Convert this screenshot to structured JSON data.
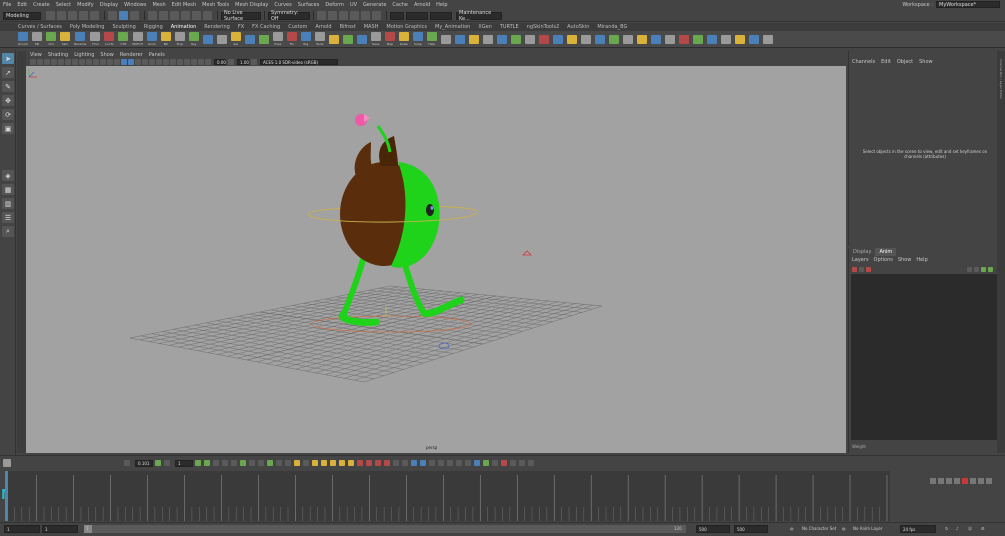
{
  "menubar": {
    "items": [
      "File",
      "Edit",
      "Create",
      "Select",
      "Modify",
      "Display",
      "Windows",
      "Mesh",
      "Edit Mesh",
      "Mesh Tools",
      "Mesh Display",
      "Curves",
      "Surfaces",
      "Deform",
      "UV",
      "Generate",
      "Cache",
      "Arnold",
      "Help"
    ],
    "workspace_label": "Workspace :",
    "workspace_value": "MyWorkspace*"
  },
  "statusline": {
    "mode": "Modeling",
    "live_surface": "No Live Surface",
    "symmetry": "Symmetry: Off",
    "renderer": "Maintenance Ke..."
  },
  "shelf": {
    "tabs": [
      "Curves / Surfaces",
      "Poly Modeling",
      "Sculpting",
      "Rigging",
      "Animation",
      "Rendering",
      "FX",
      "FX Caching",
      "Custom",
      "Arnold",
      "Bifrost",
      "MASH",
      "Motion Graphics",
      "My_Animation",
      "XGen",
      "TURTLE",
      "ngSkinTools2",
      "AutoSkin",
      "Miranda_BG"
    ],
    "active_tab": "Animation",
    "tools": [
      "Groom",
      "Pill",
      "Ctrl",
      "Skin",
      "Rename",
      "Find",
      "LocTo",
      "CTR",
      "MATCH",
      "Anim",
      "BK",
      "Flop",
      "Key",
      "",
      "",
      "Sel",
      "",
      "",
      "Pose",
      "Fix",
      "Rig",
      "Tools",
      "",
      "",
      "",
      "Save",
      "Map",
      "Scale",
      "Snap",
      "Help",
      "",
      "",
      "",
      "",
      "",
      "",
      "",
      "",
      "",
      "",
      "",
      "",
      "",
      "",
      "",
      "",
      "",
      "",
      "",
      "",
      "",
      "",
      "",
      ""
    ]
  },
  "viewport": {
    "menu": [
      "View",
      "Shading",
      "Lighting",
      "Show",
      "Renderer",
      "Panels"
    ],
    "near_clip": "0.00",
    "far_clip": "1.00",
    "color_space": "ACES 1.0 SDR-video (sRGB)",
    "camera_label": "persp"
  },
  "channelbox": {
    "menu": [
      "Channels",
      "Edit",
      "Object",
      "Show"
    ],
    "message": "Select objects in the scene to view, edit and set keyframes on channels (attributes)",
    "side_label": "Channel Box / Layer Editor"
  },
  "layereditor": {
    "tabs": [
      "Display",
      "Anim"
    ],
    "active_tab": "Anim",
    "menu": [
      "Layers",
      "Options",
      "Show",
      "Help"
    ],
    "footer": "Weight"
  },
  "timeline": {
    "current_frame": "0.101",
    "step": "1",
    "start": 1,
    "end": 120
  },
  "rangebar": {
    "start_frame": "1",
    "playback_start": "1",
    "range_start_label": "1",
    "range_end_label": "120",
    "playback_end": "500",
    "anim_end": "500",
    "character_set": "No Character Set",
    "anim_layer": "No Anim Layer",
    "fps": "24 fps"
  },
  "colors": {
    "ui_bg": "#444444",
    "viewport_bg": "#a2a2a2",
    "accent": "#5285a6",
    "character_green": "#1fd31a",
    "character_brown": "#5a2d0c",
    "flower_pink": "#ee5aa8"
  }
}
